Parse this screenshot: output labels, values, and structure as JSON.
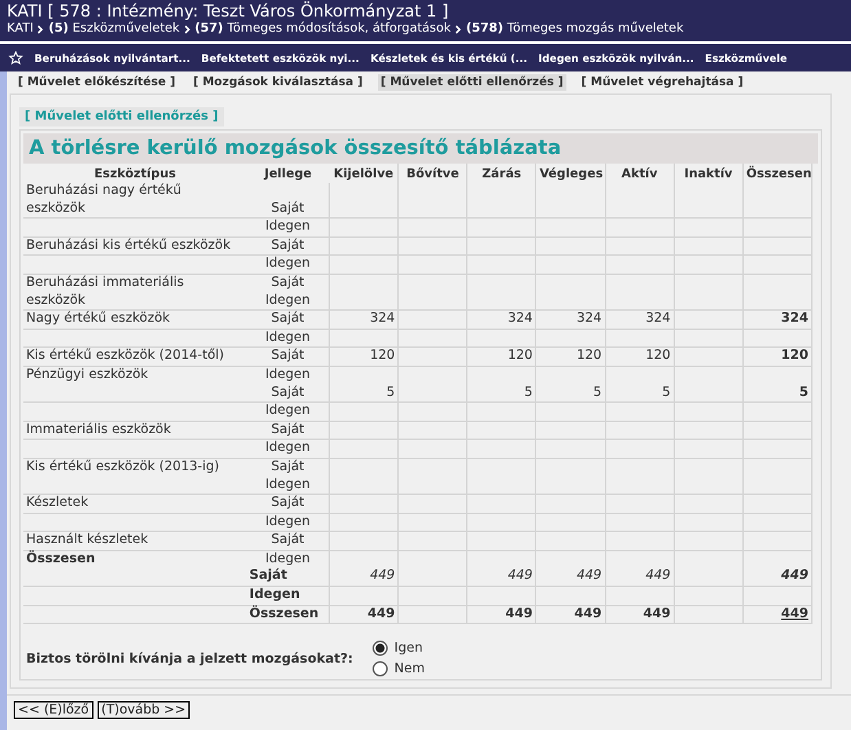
{
  "header": {
    "title": "KATI [ 578 : Intézmény: Teszt Város Önkormányzat 1 ]",
    "breadcrumb": [
      "KATI",
      "**(5)** Eszközműveletek",
      "**(57)** Tömeges módosítások, átforgatások",
      "**(578)** Tömeges mozgás műveletek"
    ]
  },
  "menu": [
    "Beruházások nyilvántart...",
    "Befektetett eszközök nyi...",
    "Készletek és kis értékű (...",
    "Idegen eszközök nyilván...",
    "Eszközművele"
  ],
  "tabs": [
    {
      "label": "[ Művelet előkészítése ]",
      "selected": false
    },
    {
      "label": "[ Mozgások kiválasztása ]",
      "selected": false
    },
    {
      "label": "[ Művelet előtti ellenőrzés ]",
      "selected": true
    },
    {
      "label": "[ Művelet végrehajtása ]",
      "selected": false
    }
  ],
  "section_label": "[ Művelet előtti ellenőrzés ]",
  "table": {
    "title": "A törlésre kerülő mozgások összesítő táblázata",
    "columns": [
      "Eszköztípus",
      "Jellege",
      "Kijelölve",
      "Bővítve",
      "Zárás",
      "Végleges",
      "Aktív",
      "Inaktív",
      "Összesen"
    ],
    "rows": [
      {
        "kind": "item",
        "name": "Beruházási nagy értékű eszközök",
        "jellege": [
          "Saját"
        ]
      },
      {
        "kind": "item",
        "jellege": [
          "Idegen"
        ]
      },
      {
        "kind": "item",
        "name": "Beruházási kis értékű eszközök",
        "jellege": [
          "Saját"
        ]
      },
      {
        "kind": "item",
        "jellege": [
          "Idegen"
        ]
      },
      {
        "kind": "item",
        "name": "Beruházási immateriális eszközök",
        "jellege": [
          "Saját",
          "Idegen"
        ]
      },
      {
        "kind": "item",
        "name": "Nagy értékű eszközök",
        "jellege": [
          "Saját"
        ],
        "values": {
          "kijelolve": "324",
          "zaras": "324",
          "vegleges": "324",
          "aktiv": "324",
          "osszesen": "324"
        }
      },
      {
        "kind": "item",
        "jellege": [
          "Idegen"
        ]
      },
      {
        "kind": "item",
        "name": "Kis értékű eszközök (2014-től)",
        "jellege": [
          "Saját"
        ],
        "values": {
          "kijelolve": "120",
          "zaras": "120",
          "vegleges": "120",
          "aktiv": "120",
          "osszesen": "120"
        }
      },
      {
        "kind": "item",
        "name": "Pénzügyi eszközök",
        "jellege": [
          "Idegen",
          "Saját"
        ],
        "values": {
          "kijelolve": "5",
          "zaras": "5",
          "vegleges": "5",
          "aktiv": "5",
          "osszesen": "5"
        }
      },
      {
        "kind": "item",
        "jellege": [
          "Idegen"
        ]
      },
      {
        "kind": "item",
        "name": "Immateriális eszközök",
        "jellege": [
          "Saját"
        ]
      },
      {
        "kind": "item",
        "jellege": [
          "Idegen"
        ]
      },
      {
        "kind": "item",
        "name": "Kis értékű eszközök (2013-ig)",
        "jellege": [
          "Saját",
          "Idegen"
        ]
      },
      {
        "kind": "item",
        "name": "Készletek",
        "jellege": [
          "Saját"
        ]
      },
      {
        "kind": "item",
        "jellege": [
          "Idegen"
        ]
      },
      {
        "kind": "item",
        "name": "Használt készletek",
        "jellege": [
          "Saját"
        ]
      },
      {
        "kind": "total",
        "name": "Összesen",
        "jellege": [
          "Idegen",
          "Saját"
        ],
        "values": {
          "kijelolve": "449",
          "zaras": "449",
          "vegleges": "449",
          "aktiv": "449",
          "osszesen": "449"
        }
      },
      {
        "kind": "subtotal",
        "jellege": [
          "Idegen"
        ]
      },
      {
        "kind": "grand",
        "jellege": [
          "Összesen"
        ],
        "values": {
          "kijelolve": "449",
          "zaras": "449",
          "vegleges": "449",
          "aktiv": "449",
          "osszesen": "449"
        }
      }
    ]
  },
  "question": {
    "label": "Biztos törölni kívánja a jelzett mozgásokat?:",
    "options": [
      {
        "label": "Igen",
        "selected": true
      },
      {
        "label": "Nem",
        "selected": false
      }
    ]
  },
  "buttons": [
    "<< (E)lőző",
    "(T)ovább >>"
  ]
}
